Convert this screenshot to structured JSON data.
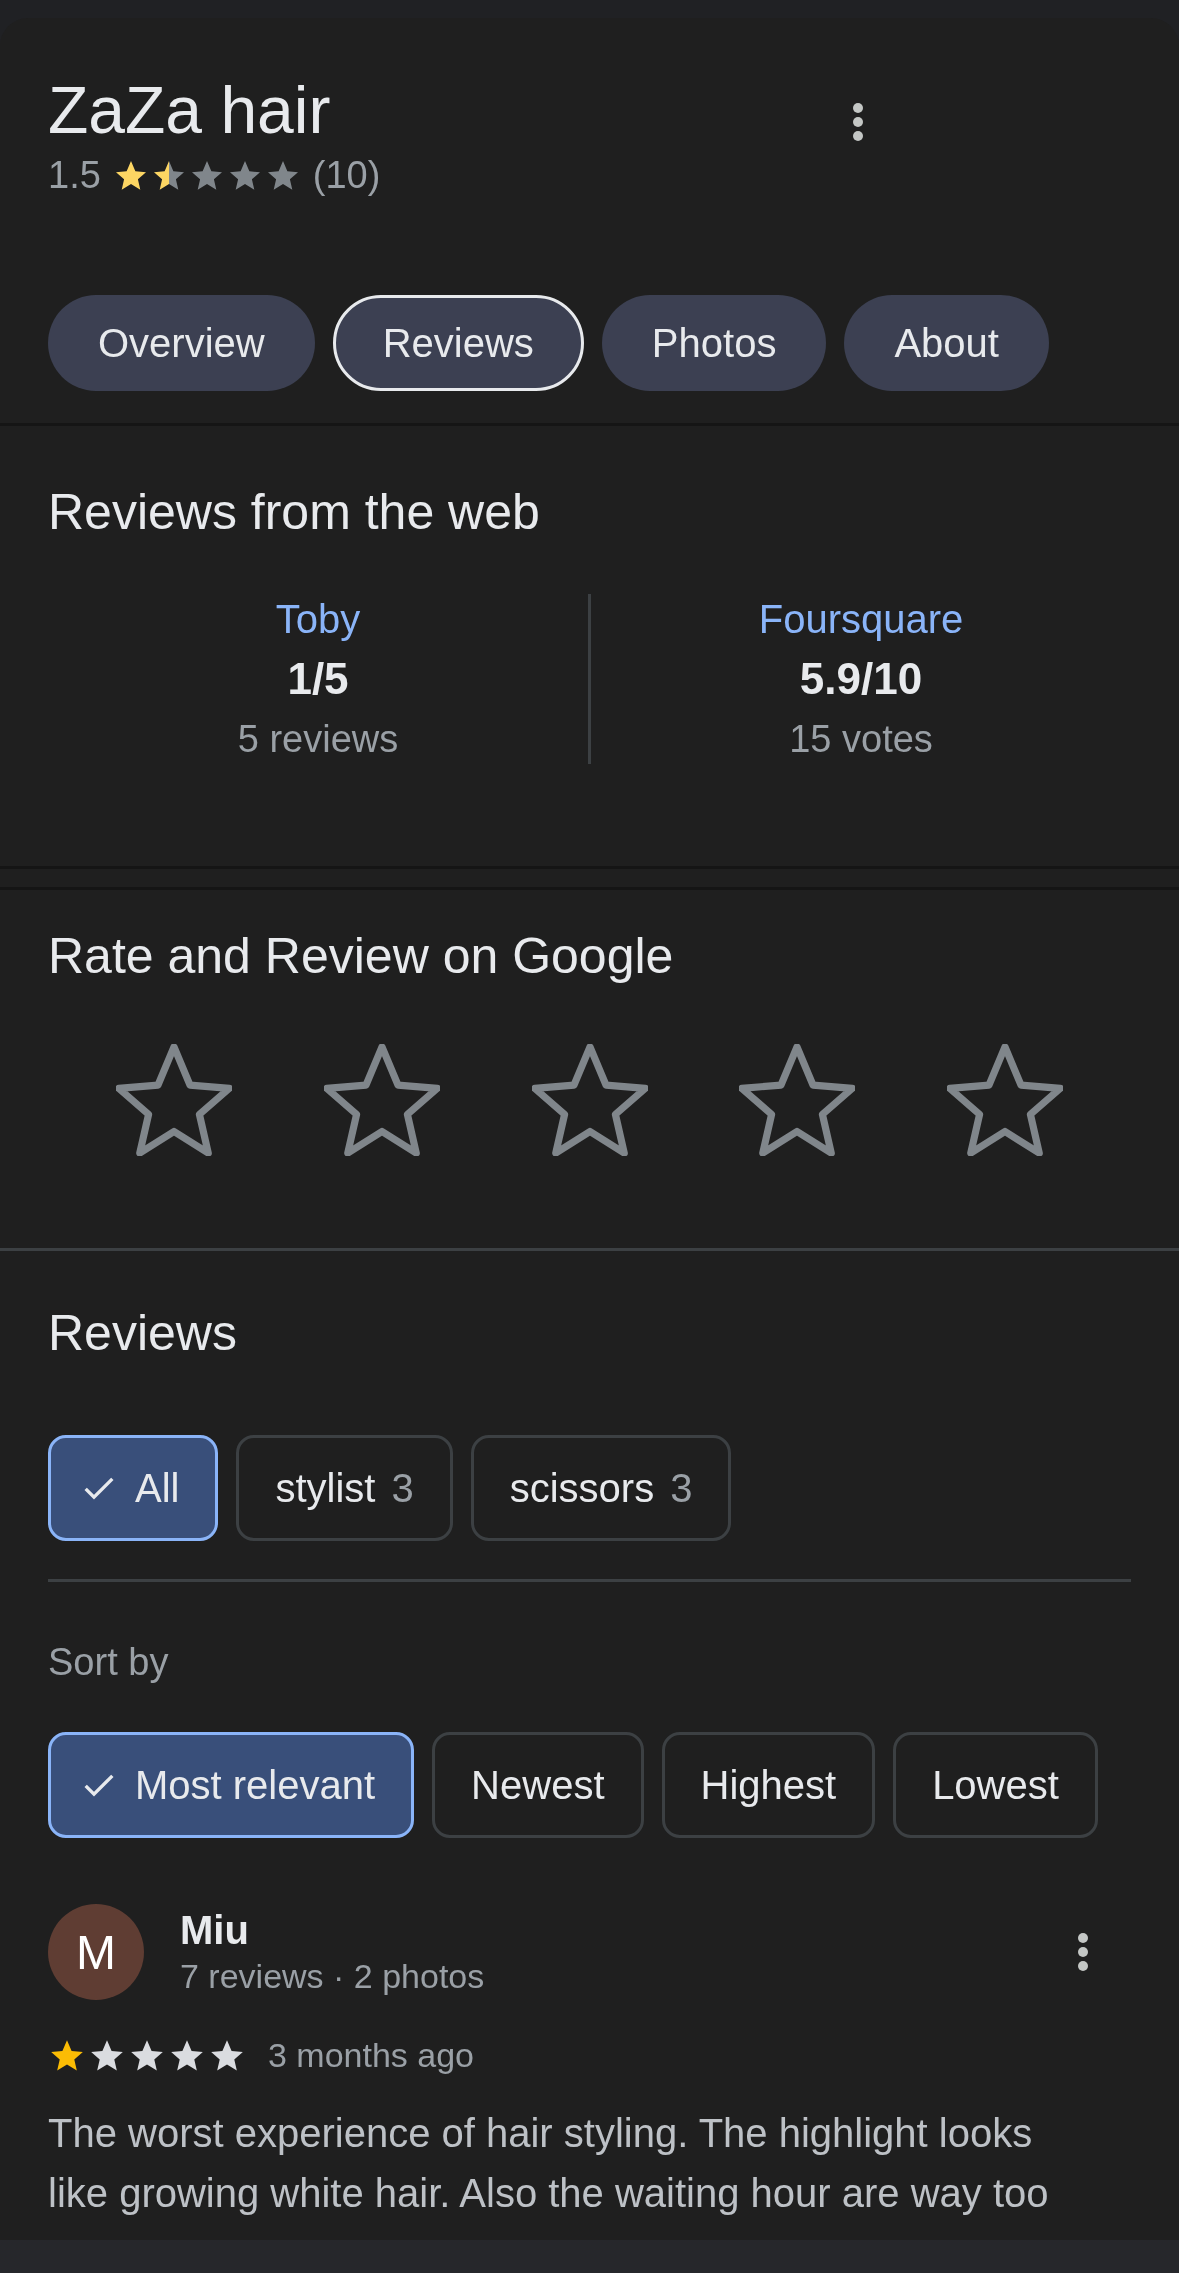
{
  "place": {
    "name": "ZaZa hair",
    "rating": "1.5",
    "stars": 1.5,
    "count": "(10)"
  },
  "tabs": [
    {
      "label": "Overview",
      "selected": false
    },
    {
      "label": "Reviews",
      "selected": true
    },
    {
      "label": "Photos",
      "selected": false
    },
    {
      "label": "About",
      "selected": false
    }
  ],
  "web_reviews": {
    "title": "Reviews from the web",
    "sources": [
      {
        "name": "Toby",
        "score": "1/5",
        "count": "5 reviews"
      },
      {
        "name": "Foursquare",
        "score": "5.9/10",
        "count": "15 votes"
      }
    ]
  },
  "rate": {
    "title": "Rate and Review on Google"
  },
  "reviews": {
    "title": "Reviews",
    "filters": [
      {
        "label": "All",
        "selected": true
      },
      {
        "label": "stylist",
        "count": "3",
        "selected": false
      },
      {
        "label": "scissors",
        "count": "3",
        "selected": false
      }
    ],
    "sort_label": "Sort by",
    "sort_options": [
      {
        "label": "Most relevant",
        "selected": true
      },
      {
        "label": "Newest",
        "selected": false
      },
      {
        "label": "Highest",
        "selected": false
      },
      {
        "label": "Lowest",
        "selected": false
      }
    ],
    "items": [
      {
        "initial": "M",
        "name": "Miu",
        "meta": "7 reviews · 2 photos",
        "stars": 1,
        "time": "3 months ago",
        "text": "The worst experience of hair styling. The highlight looks like growing white hair. Also the waiting hour are way too"
      }
    ]
  }
}
